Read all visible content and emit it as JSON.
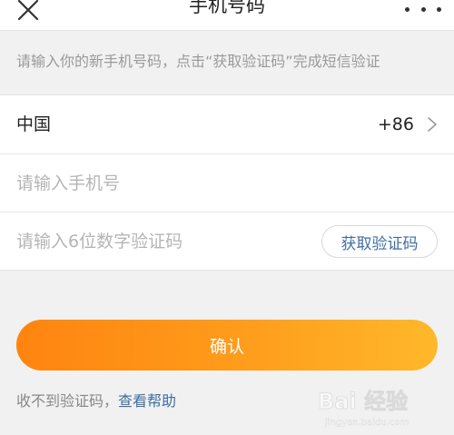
{
  "header": {
    "title": "手机号码",
    "close_icon": "close-icon",
    "more_icon": "more-icon"
  },
  "hint": "请输入你的新手机号码，点击“获取验证码”完成短信验证",
  "form": {
    "country": {
      "label": "中国",
      "code": "+86",
      "icon": "chevron-right-icon"
    },
    "phone": {
      "placeholder": "请输入手机号",
      "value": ""
    },
    "verify": {
      "placeholder": "请输入6位数字验证码",
      "value": "",
      "button_label": "获取验证码"
    }
  },
  "confirm_label": "确认",
  "help": {
    "text": "收不到验证码，",
    "link": "查看帮助"
  },
  "watermark": {
    "text": "Bai 经验",
    "sub": "jingyan.baidu.com"
  },
  "colors": {
    "accent_start": "#ff8410",
    "accent_end": "#ffb82a",
    "link": "#3f6ea3",
    "hint": "#9a9a9a"
  }
}
